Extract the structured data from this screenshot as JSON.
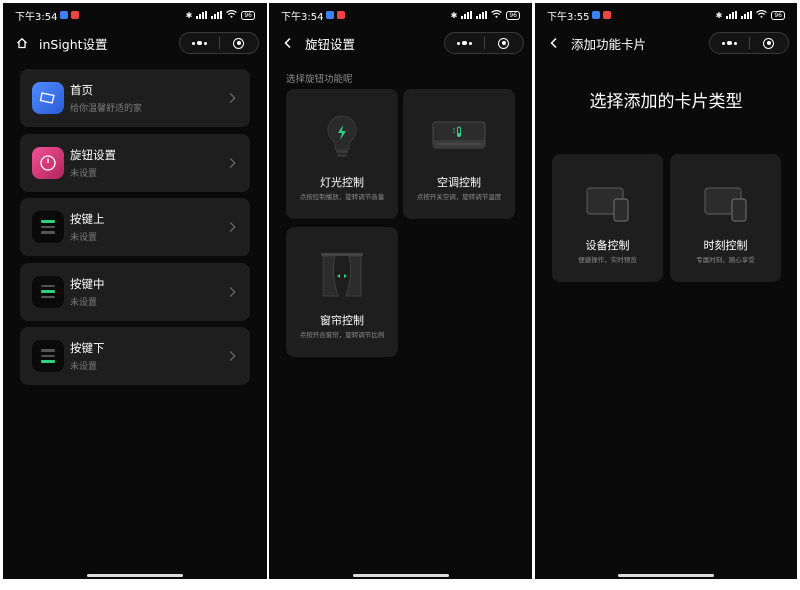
{
  "status": {
    "time1": "下午3:54",
    "time2": "下午3:54",
    "time3": "下午3:55",
    "battery": "96"
  },
  "screen1": {
    "title": "inSight设置",
    "items": [
      {
        "title": "首页",
        "subtitle": "给你温馨舒适的家"
      },
      {
        "title": "旋钮设置",
        "subtitle": "未设置"
      },
      {
        "title": "按键上",
        "subtitle": "未设置"
      },
      {
        "title": "按键中",
        "subtitle": "未设置"
      },
      {
        "title": "按键下",
        "subtitle": "未设置"
      }
    ]
  },
  "screen2": {
    "title": "旋钮设置",
    "section_label": "选择旋钮功能呢",
    "cards": [
      {
        "title": "灯光控制",
        "desc": "点按控制播放，旋转调节音量"
      },
      {
        "title": "空调控制",
        "desc": "点按开关空调，旋转调节温度"
      },
      {
        "title": "窗帘控制",
        "desc": "点按开合窗帘，旋转调节比例"
      }
    ]
  },
  "screen3": {
    "title": "添加功能卡片",
    "heading": "选择添加的卡片类型",
    "cards": [
      {
        "title": "设备控制",
        "desc": "便捷操作，实时预览"
      },
      {
        "title": "时刻控制",
        "desc": "专属时刻，随心享受"
      }
    ]
  },
  "colors": {
    "background": "#0a0a0a",
    "card": "#1e1e1e",
    "accent_green": "#2fd07f",
    "home_blue": "#4f8cff",
    "knob_pink": "#f0519a"
  },
  "icons": [
    "home-icon",
    "back-icon",
    "more-icon",
    "target-icon",
    "chevron-right-icon",
    "bulb-icon",
    "aircon-icon",
    "curtain-icon",
    "device-card-icon"
  ]
}
